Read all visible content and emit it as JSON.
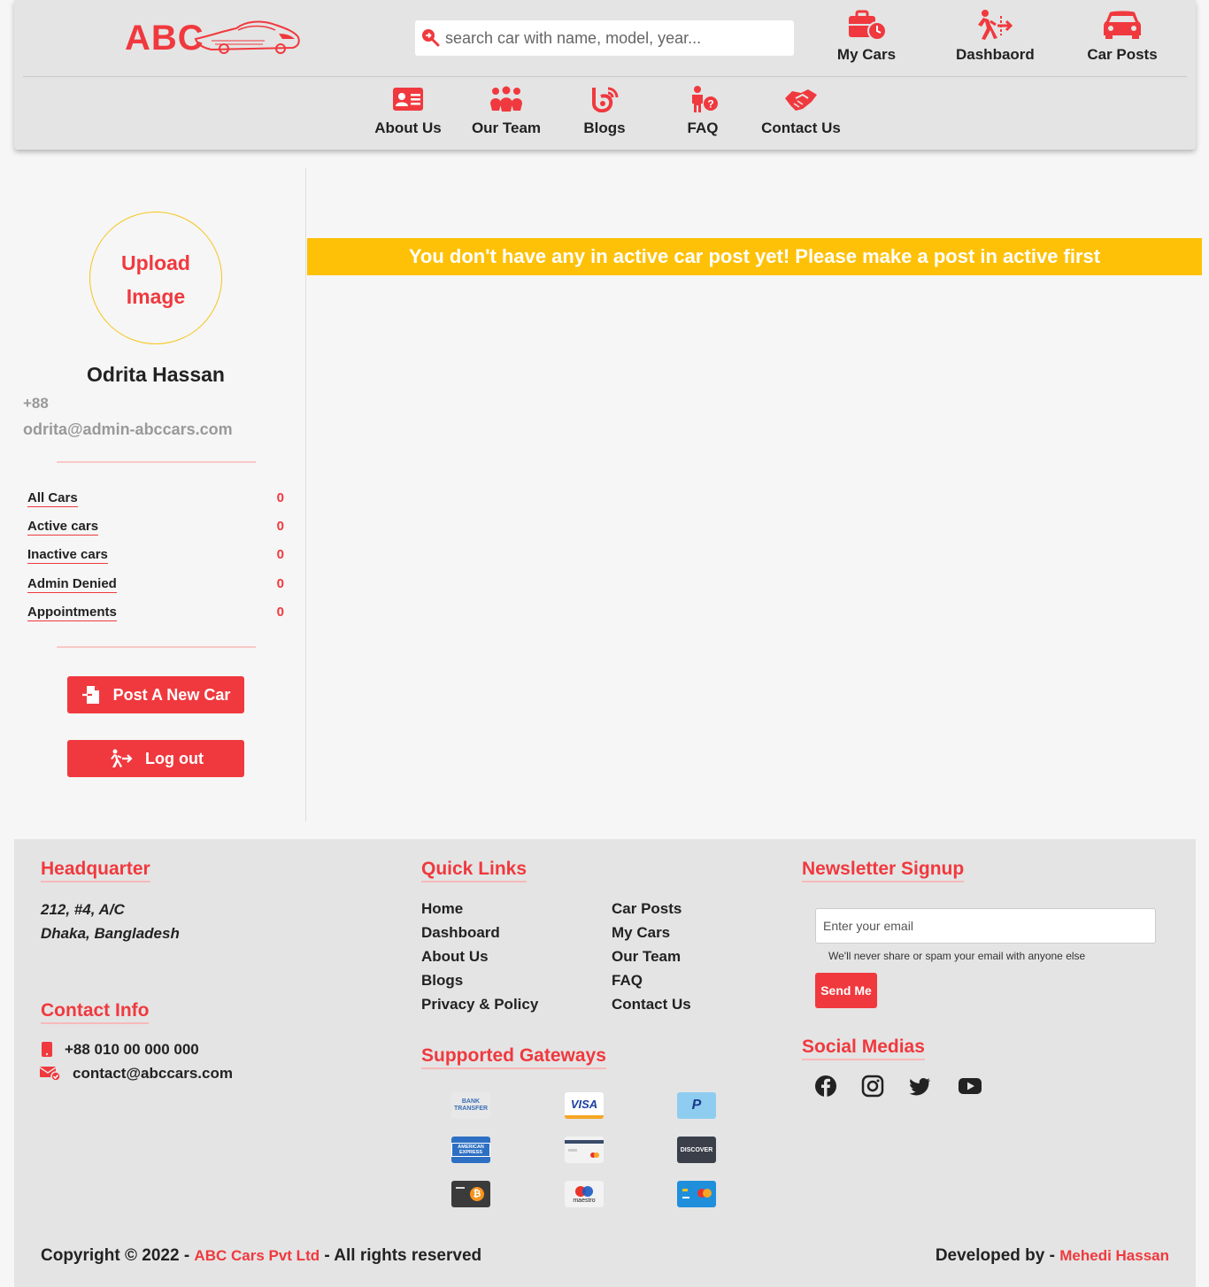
{
  "brand": {
    "logo_text": "ABC",
    "accent_color": "#f0393e",
    "notice_color": "#fec107"
  },
  "search": {
    "placeholder": "search car with name, model, year..."
  },
  "top_nav": [
    {
      "label": "My Cars",
      "icon": "briefcase-clock-icon"
    },
    {
      "label": "Dashbaord",
      "icon": "person-exit-icon"
    },
    {
      "label": "Car Posts",
      "icon": "car-icon"
    }
  ],
  "sub_nav": [
    {
      "label": "About Us",
      "icon": "id-card-icon"
    },
    {
      "label": "Our Team",
      "icon": "people-group-icon"
    },
    {
      "label": "Blogs",
      "icon": "blog-icon"
    },
    {
      "label": "FAQ",
      "icon": "person-question-icon"
    },
    {
      "label": "Contact Us",
      "icon": "handshake-icon"
    }
  ],
  "profile": {
    "upload_label_1": "Upload",
    "upload_label_2": "Image",
    "name": "Odrita Hassan",
    "phone": "+88",
    "email": "odrita@admin-abccars.com"
  },
  "stats": [
    {
      "label": "All Cars",
      "count": "0"
    },
    {
      "label": "Active cars",
      "count": "0"
    },
    {
      "label": "Inactive cars",
      "count": "0"
    },
    {
      "label": "Admin Denied",
      "count": "0"
    },
    {
      "label": "Appointments",
      "count": "0"
    }
  ],
  "buttons": {
    "post_car": "Post A New Car",
    "logout": "Log out"
  },
  "notice": "You don't have any in active car post yet! Please make a post in active first",
  "footer": {
    "headquarter_title": "Headquarter",
    "address_line1": "212, #4, A/C",
    "address_line2": "Dhaka, Bangladesh",
    "contact_title": "Contact Info",
    "phone": "+88 010 00 000 000",
    "email": "contact@abccars.com",
    "quick_links_title": "Quick Links",
    "quick_links_col1": [
      "Home",
      "Dashboard",
      "About Us",
      "Blogs",
      "Privacy & Policy"
    ],
    "quick_links_col2": [
      "Car Posts",
      "My Cars",
      "Our Team",
      "FAQ",
      "Contact Us"
    ],
    "gateways_title": "Supported Gateways",
    "gateways": [
      {
        "name": "bank-transfer",
        "text": "BANK TRANSFER"
      },
      {
        "name": "visa",
        "text": "VISA"
      },
      {
        "name": "paypal",
        "text": "P"
      },
      {
        "name": "american-express",
        "text": "AMERICAN EXPRESS"
      },
      {
        "name": "generic-card",
        "text": ""
      },
      {
        "name": "discover",
        "text": "DISCOVER"
      },
      {
        "name": "bitcoin",
        "text": "₿"
      },
      {
        "name": "maestro",
        "text": "maestro"
      },
      {
        "name": "mastercard-card",
        "text": ""
      }
    ],
    "newsletter_title": "Newsletter Signup",
    "newsletter_placeholder": "Enter your email",
    "newsletter_help": "We'll never share or spam your email with anyone else",
    "send_label": "Send Me",
    "social_title": "Social Medias",
    "socials": [
      "facebook-icon",
      "instagram-icon",
      "twitter-icon",
      "youtube-icon"
    ],
    "copyright_prefix": "Copyright © 2022 - ",
    "copyright_company": "ABC Cars Pvt Ltd",
    "copyright_suffix": " - All rights reserved",
    "dev_prefix": "Developed by - ",
    "dev_name": "Mehedi Hassan"
  }
}
